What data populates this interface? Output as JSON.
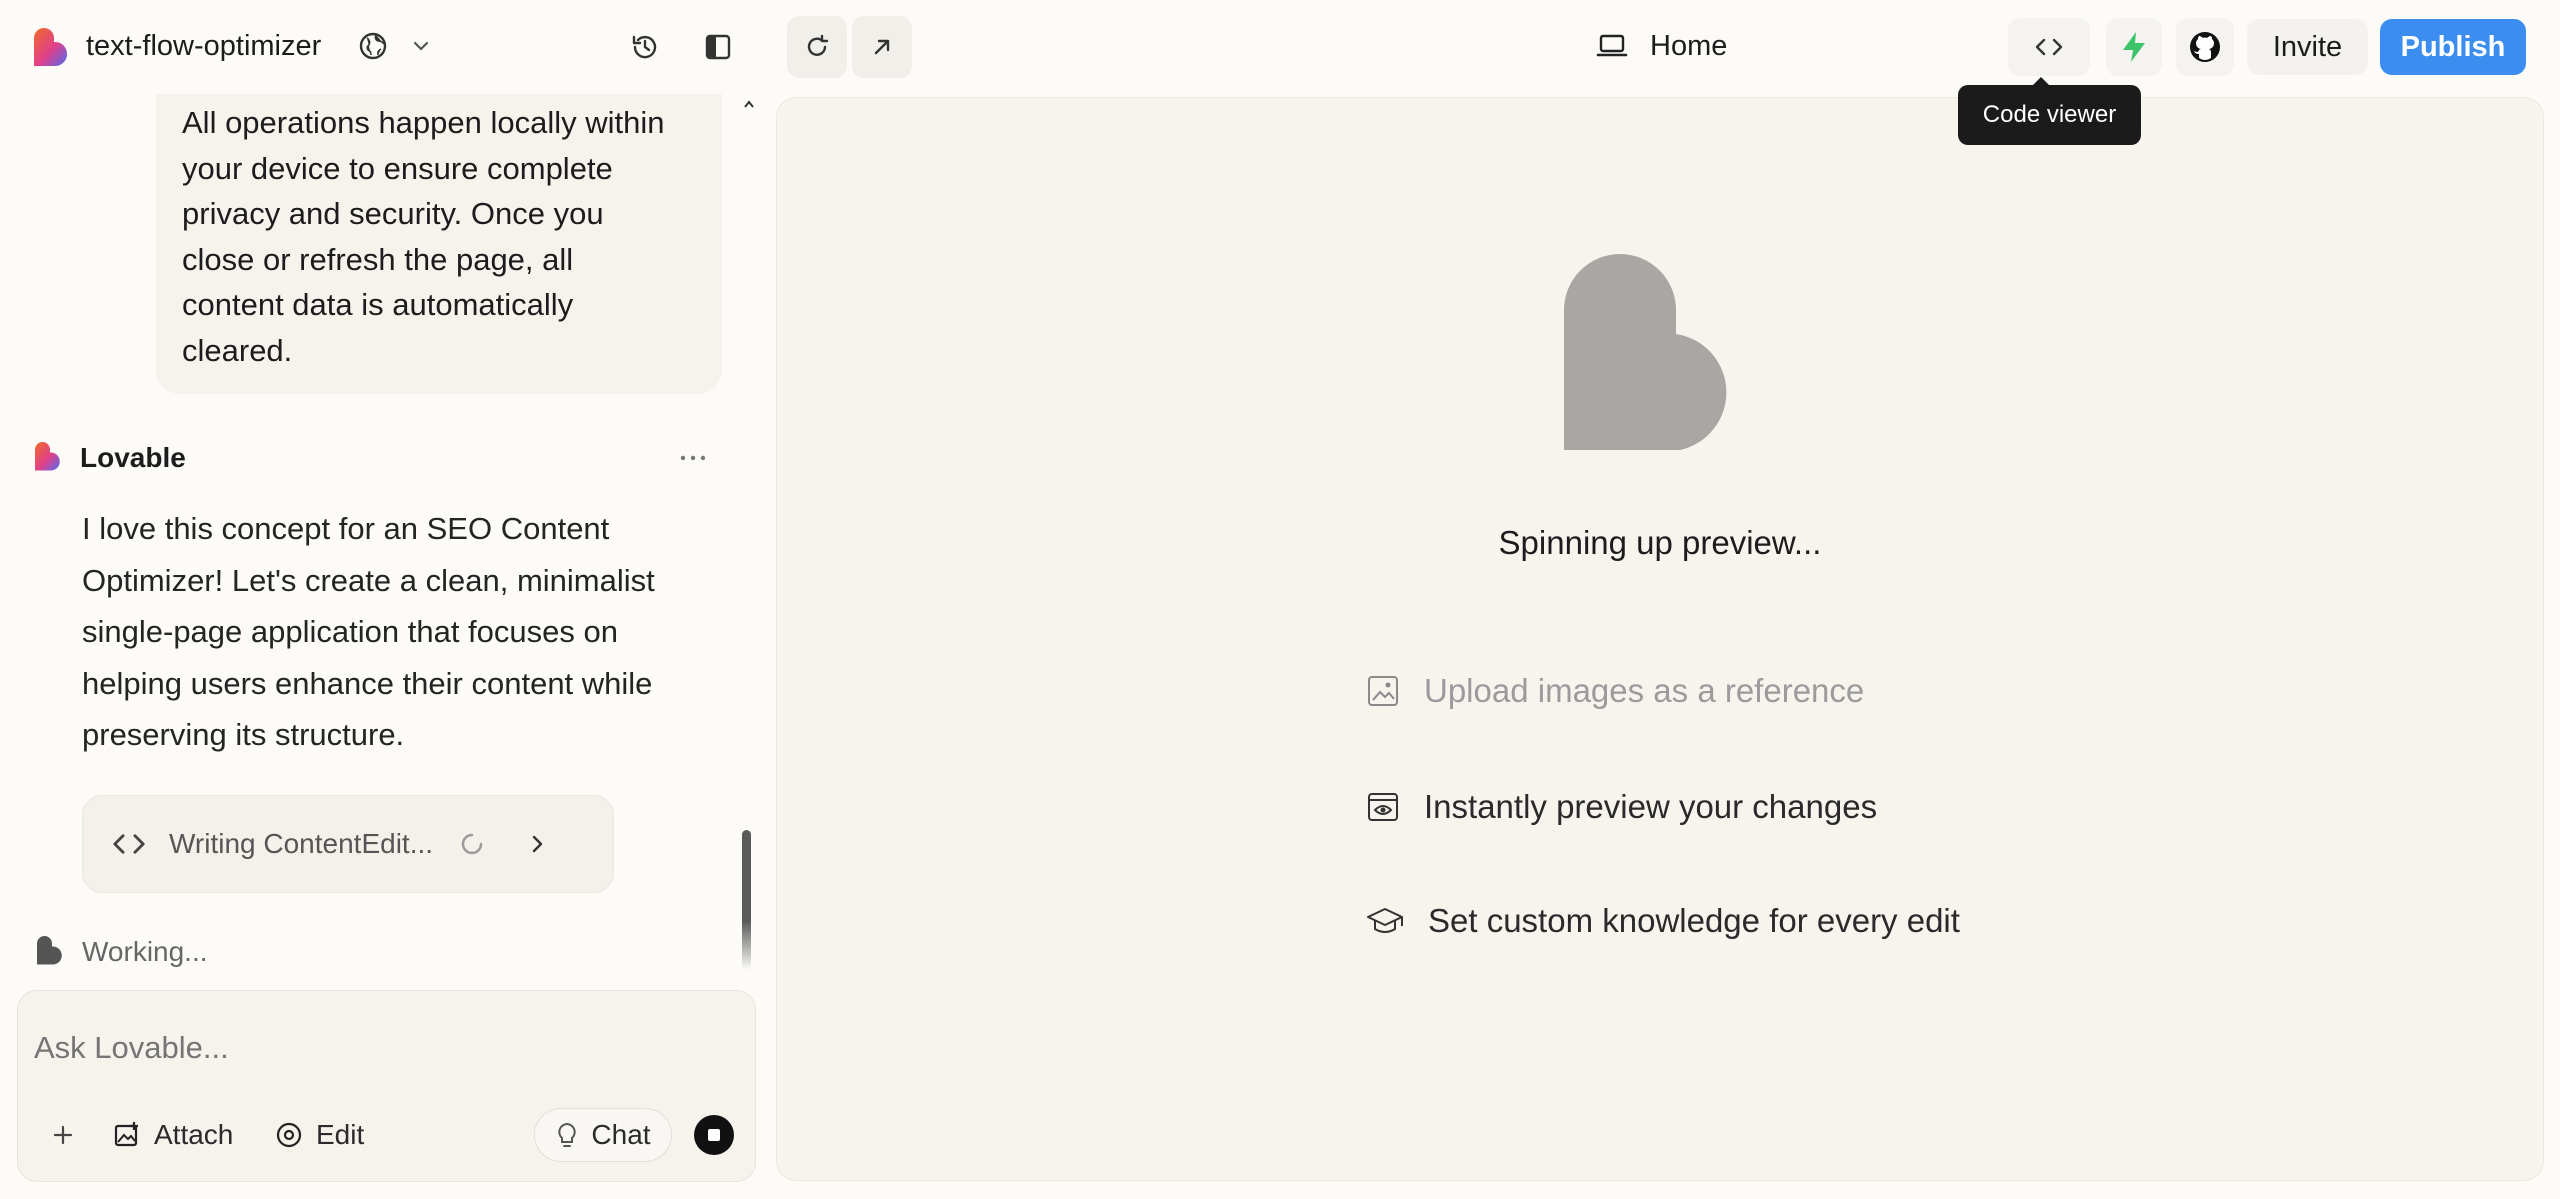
{
  "project": {
    "name": "text-flow-optimizer"
  },
  "preview_url": {
    "label": "Home"
  },
  "header": {
    "invite_label": "Invite",
    "publish_label": "Publish",
    "tooltip": "Code viewer"
  },
  "chat": {
    "user_message_lines": [
      "All operations happen locally within",
      "your device to ensure complete",
      "privacy and security. Once you",
      "close or refresh the page, all",
      "content data is automatically",
      "cleared."
    ],
    "assistant": {
      "name": "Lovable",
      "message_lines": [
        "I love this concept for an SEO Content",
        "Optimizer! Let's create a clean, minimalist",
        "single-page application that focuses on",
        "helping users enhance their content while",
        "preserving its structure."
      ],
      "tool_label": "Writing ContentEdit..."
    },
    "status": "Working..."
  },
  "composer": {
    "placeholder": "Ask Lovable...",
    "attach_label": "Attach",
    "edit_label": "Edit",
    "chat_label": "Chat"
  },
  "preview": {
    "status": "Spinning up preview...",
    "features": [
      {
        "icon": "image-icon",
        "label": "Upload images as a reference",
        "muted": true
      },
      {
        "icon": "eye-icon",
        "label": "Instantly preview your changes",
        "muted": false
      },
      {
        "icon": "graduation-cap-icon",
        "label": "Set custom knowledge for every edit",
        "muted": false
      }
    ]
  },
  "colors": {
    "accent": "#3c8df0",
    "background": "#fcfbf8",
    "bolt": "#3cc46b",
    "logo_orange": "#f26a2a",
    "logo_pink": "#e0408a",
    "logo_blue": "#4f6bf0"
  }
}
